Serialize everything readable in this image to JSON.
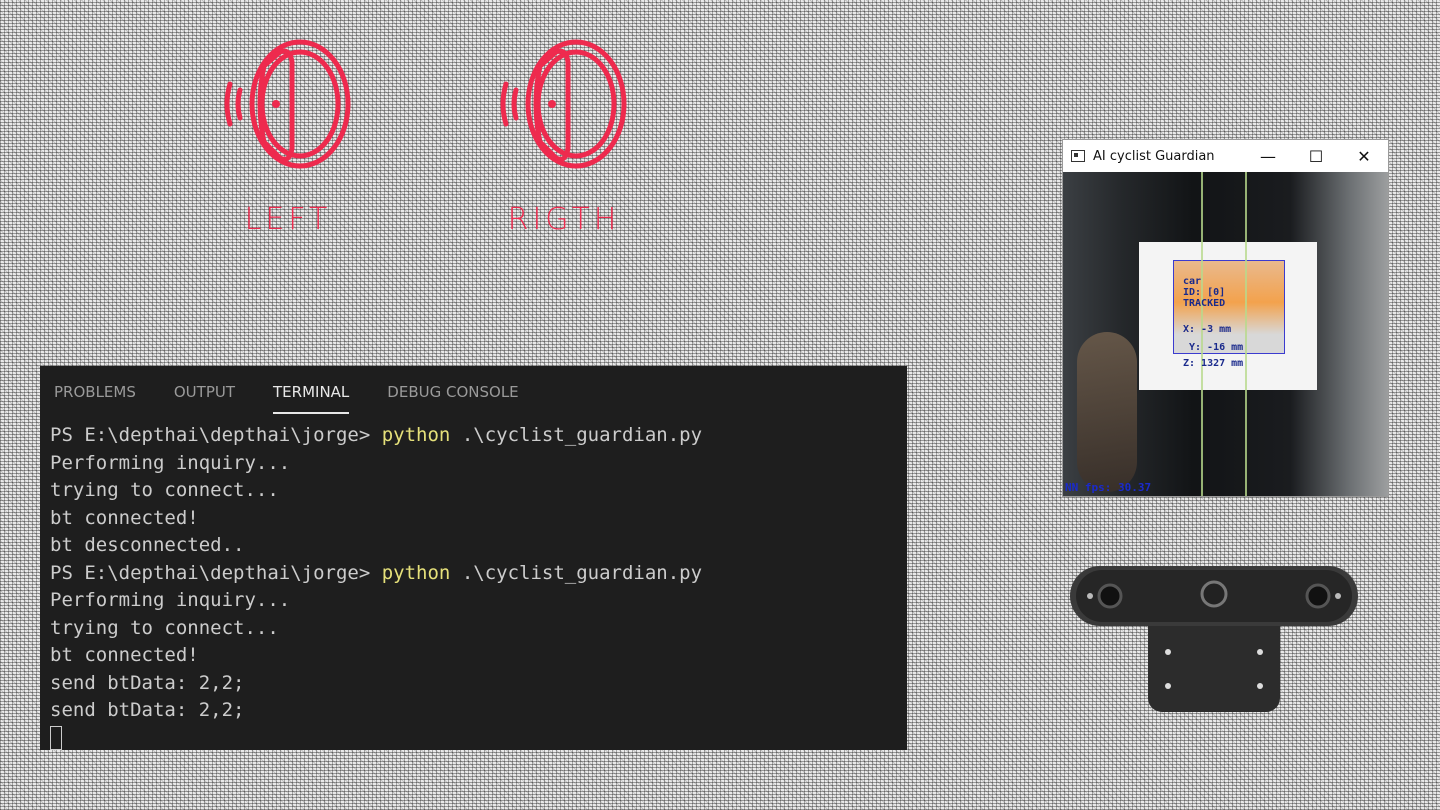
{
  "bands": {
    "left_label": "LEFT",
    "right_label": "RIGTH",
    "accent_color": "#ee2a4e",
    "icon_name": "smart-band-vibrating-icon"
  },
  "terminal": {
    "tabs": [
      "PROBLEMS",
      "OUTPUT",
      "TERMINAL",
      "DEBUG CONSOLE"
    ],
    "active_tab": "TERMINAL",
    "lines": [
      {
        "prompt": "PS E:\\depthai\\depthai\\jorge> ",
        "cmd": "python",
        "args": " .\\cyclist_guardian.py"
      },
      {
        "text": "Performing inquiry..."
      },
      {
        "text": "trying to connect..."
      },
      {
        "text": "bt connected!"
      },
      {
        "text": "bt desconnected.."
      },
      {
        "prompt": "PS E:\\depthai\\depthai\\jorge> ",
        "cmd": "python",
        "args": " .\\cyclist_guardian.py"
      },
      {
        "text": "Performing inquiry..."
      },
      {
        "text": "trying to connect..."
      },
      {
        "text": "bt connected!"
      },
      {
        "text": "send btData: 2,2;"
      },
      {
        "text": "send btData: 2,2;"
      }
    ]
  },
  "camera_window": {
    "title": "AI cyclist Guardian",
    "minimize": "—",
    "maximize": "☐",
    "close": "✕",
    "detection": {
      "label_line1": "car",
      "label_line2": "ID: [0]",
      "label_line3": "TRACKED",
      "label_x": "X: -3 mm",
      "label_y": "Y: -16 mm",
      "label_z": "Z: 1327 mm"
    },
    "fps": "NN fps: 30.37"
  }
}
